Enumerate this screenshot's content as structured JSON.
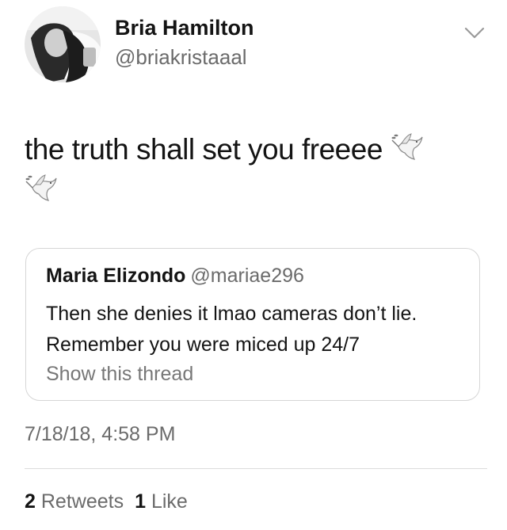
{
  "author": {
    "display_name": "Bria Hamilton",
    "handle": "@briakristaaal",
    "avatar": "profile-photo"
  },
  "menu_icon": "chevron-down-icon",
  "tweet": {
    "text": "the truth shall set you freeee",
    "emoji": [
      "dove-icon",
      "dove-icon"
    ]
  },
  "quoted_tweet": {
    "display_name": "Maria Elizondo",
    "handle": "@mariae296",
    "text": "Then she denies it lmao cameras don’t lie. Remember you were miced up 24/7",
    "show_thread_label": "Show this thread"
  },
  "timestamp": "7/18/18, 4:58 PM",
  "stats": {
    "retweets_count": "2",
    "retweets_label": "Retweets",
    "likes_count": "1",
    "likes_label": "Like"
  },
  "colors": {
    "text": "#141414",
    "secondary_text": "#6b6b6b",
    "border": "#d6d6d6"
  }
}
